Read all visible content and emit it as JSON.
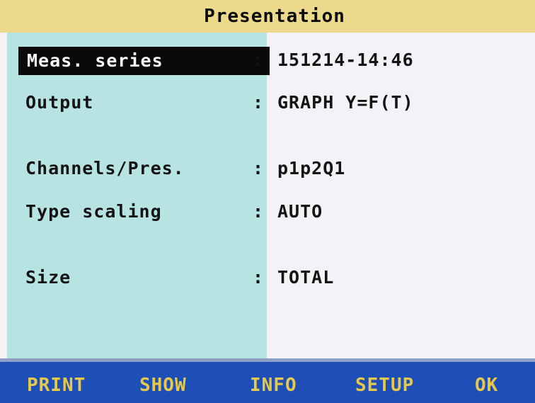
{
  "title": "Presentation",
  "fields": [
    {
      "label": "Meas. series",
      "colon": ":",
      "value": "151214-14:46",
      "selected": true
    },
    {
      "label": "Output",
      "colon": ":",
      "value": "GRAPH Y=F(T)",
      "selected": false
    },
    {
      "label": "Channels/Pres.",
      "colon": ":",
      "value": "p1p2Q1",
      "selected": false
    },
    {
      "label": "Type scaling",
      "colon": ":",
      "value": "AUTO",
      "selected": false
    },
    {
      "label": "Size",
      "colon": ":",
      "value": "TOTAL",
      "selected": false
    }
  ],
  "menu": {
    "print": "PRINT",
    "show": "SHOW",
    "info": "INFO",
    "setup": "SETUP",
    "ok": "OK"
  },
  "colors": {
    "title_bg": "#ecd98c",
    "left_panel_bg": "#b8e3e3",
    "right_panel_bg": "#f4f2f6",
    "menu_bg": "#1e4fb6",
    "menu_text": "#e6c84a",
    "selection_bg": "#0a0a0a",
    "selection_text": "#f8f8f8"
  }
}
